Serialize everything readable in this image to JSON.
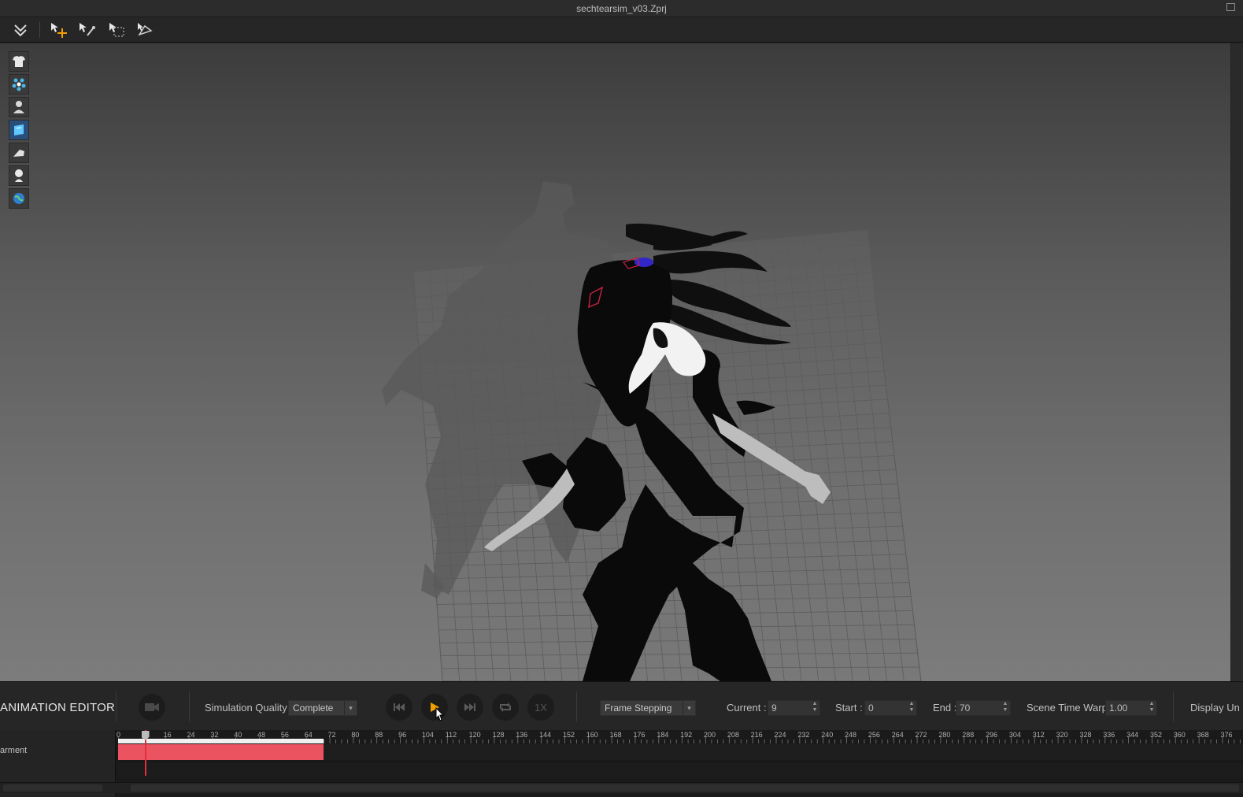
{
  "window": {
    "title": "sechtearsim_v03.Zprj"
  },
  "toolbar": {
    "tools": [
      "simulation-icon",
      "select-move-icon",
      "edit-pattern-icon",
      "transform-icon",
      "pin-icon"
    ]
  },
  "viewport": {
    "side_tools": [
      "garment-icon",
      "particle-icon",
      "avatar-icon",
      "pattern-2d-icon",
      "fabric-icon",
      "avatar-silhouette-icon",
      "environment-icon"
    ]
  },
  "animation_editor": {
    "title": "ANIMATION EDITOR",
    "simulation_quality_label": "Simulation Quality",
    "simulation_quality_value": "Complete",
    "speed_label": "1X",
    "frame_mode_value": "Frame Stepping",
    "current_label": "Current :",
    "current_value": "9",
    "start_label": "Start :",
    "start_value": "0",
    "end_label": "End :",
    "end_value": "70",
    "time_warp_label": "Scene Time Warp",
    "time_warp_value": "1.00",
    "display_units_label": "Display Un"
  },
  "timeline": {
    "tick_labels": [
      "0",
      "16",
      "24",
      "32",
      "40",
      "48",
      "56",
      "64",
      "72",
      "80",
      "88",
      "96",
      "104",
      "112",
      "120",
      "128",
      "136",
      "144",
      "152",
      "160",
      "168",
      "176",
      "184",
      "192",
      "200",
      "208",
      "216",
      "224",
      "232",
      "240",
      "248",
      "256",
      "264",
      "272",
      "280",
      "288",
      "296",
      "304",
      "312",
      "320",
      "328",
      "336",
      "344",
      "352",
      "360",
      "368",
      "376"
    ],
    "current_frame": 9,
    "range_end": 70,
    "track_label": "arment",
    "clip_color": "#ec5360"
  },
  "colors": {
    "accent": "#f0a000",
    "playhead": "#e0303a"
  }
}
